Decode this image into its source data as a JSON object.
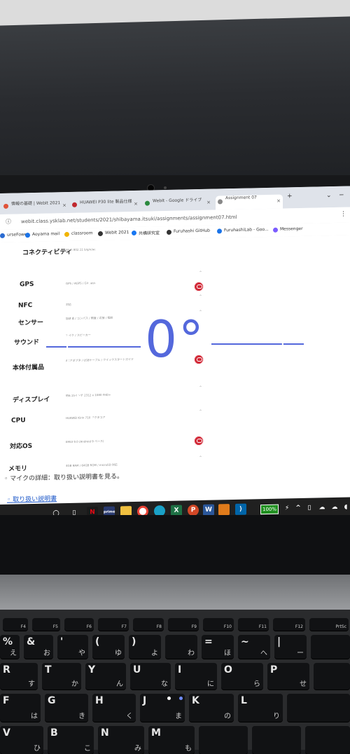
{
  "browser": {
    "tabs": [
      {
        "title": "情報の基礎 | WebIt 2021",
        "color": "#e0533a"
      },
      {
        "title": "HUAWEI P30 lite 製品仕様",
        "color": "#c0282e"
      },
      {
        "title": "WebIt - Google ドライブ",
        "color": "#2b8a3e"
      },
      {
        "title": "Assignment 07",
        "color": "#888888"
      }
    ],
    "url": "webit.class.ysklab.net/students/2021/shibayama.itsuki/assignments/assignment07.html",
    "bookmarks": [
      {
        "label": "urseFowe",
        "color": "#2b6cd2"
      },
      {
        "label": "Aoyama mail",
        "color": "#1a73e8"
      },
      {
        "label": "classroom",
        "color": "#f1b400"
      },
      {
        "label": "WebIt 2021",
        "color": "#333333"
      },
      {
        "label": "共構研究室",
        "color": "#1877f2"
      },
      {
        "label": "Furuhashi GitHub",
        "color": "#333333"
      },
      {
        "label": "FuruhashiLab - Goo...",
        "color": "#1a73e8"
      },
      {
        "label": "Messenger",
        "color": "#7b5cff"
      }
    ]
  },
  "spec_rows": [
    {
      "label": "コネクティビティ",
      "desc": "Wi-Fi 802.11 b/g/n/ac"
    },
    {
      "label": "GPS",
      "desc": "GPS / AGPS / Glonass"
    },
    {
      "label": "NFC",
      "desc": "対応"
    },
    {
      "label": "センサー",
      "desc": "加速度 / コンパス / 照度 / 近接 / 指紋"
    },
    {
      "label": "サウンド",
      "desc": "マイク / スピーカー"
    },
    {
      "label": "本体付属品",
      "desc": "ACアダプタ / USBケーブル / クイックスタートガイド"
    },
    {
      "label": "ディスプレイ",
      "desc": "約6.15インチ 2312 x 1080 FHD+"
    },
    {
      "label": "CPU",
      "desc": "HUAWEI Kirin 710 オクタコア"
    },
    {
      "label": "対応OS",
      "desc": "EMUI 9.0 (Android 9 ベース)"
    },
    {
      "label": "メモリ",
      "desc": "4GB RAM / 64GB ROM / microSD 対応"
    }
  ],
  "page_note": "マイクの詳細：取り扱い説明書を見る。",
  "page_link": "取り扱い説明書",
  "battery": "100%",
  "level": {
    "angle": "0°",
    "accent": "#5468dc"
  },
  "keyboard": {
    "fn_row": [
      "F4",
      "F5",
      "F6",
      "F7",
      "F8",
      "F9",
      "F10",
      "F11",
      "F12",
      "PrtSc"
    ],
    "num_row": [
      {
        "main": "%",
        "kana": "え"
      },
      {
        "main": "&",
        "kana": "お"
      },
      {
        "main": "'",
        "kana": "や"
      },
      {
        "main": "(",
        "kana": "ゆ"
      },
      {
        "main": ")",
        "kana": "よ"
      },
      {
        "main": "",
        "kana": "わ"
      },
      {
        "main": "=",
        "kana": "ほ"
      },
      {
        "main": "~",
        "kana": "へ"
      },
      {
        "main": "|",
        "kana": "ー"
      }
    ],
    "top_row": [
      {
        "main": "R",
        "kana": "す"
      },
      {
        "main": "T",
        "kana": "か"
      },
      {
        "main": "Y",
        "kana": "ん"
      },
      {
        "main": "U",
        "kana": "な"
      },
      {
        "main": "I",
        "kana": "に"
      },
      {
        "main": "O",
        "kana": "ら"
      },
      {
        "main": "P",
        "kana": "せ"
      }
    ],
    "home_row": [
      {
        "main": "F",
        "kana": "は"
      },
      {
        "main": "G",
        "kana": "き"
      },
      {
        "main": "H",
        "kana": "く"
      },
      {
        "main": "J",
        "kana": "ま"
      },
      {
        "main": "K",
        "kana": "の"
      },
      {
        "main": "L",
        "kana": "り"
      }
    ],
    "bottom_row": [
      {
        "main": "V",
        "kana": "ひ"
      },
      {
        "main": "B",
        "kana": "こ"
      },
      {
        "main": "N",
        "kana": "み"
      },
      {
        "main": "M",
        "kana": "も"
      }
    ]
  }
}
